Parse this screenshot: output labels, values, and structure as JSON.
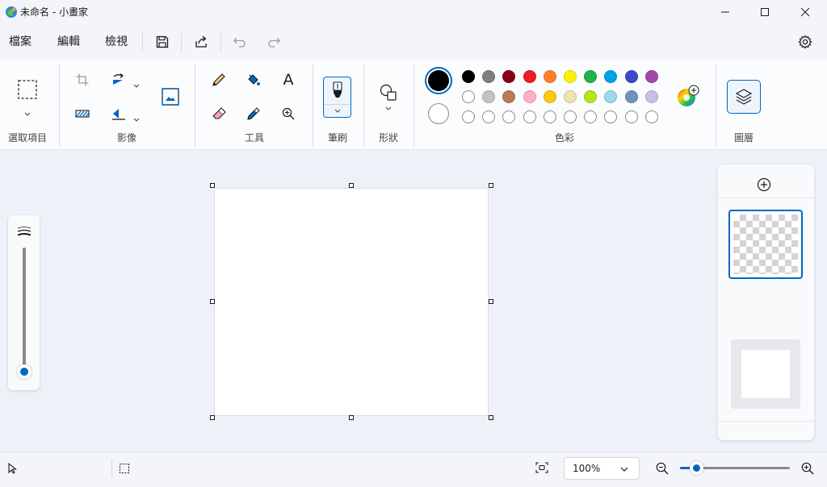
{
  "window": {
    "title": "未命名 - 小畫家",
    "icons": [
      "app-icon",
      "minimize-icon",
      "maximize-icon",
      "close-icon"
    ]
  },
  "menu": {
    "items": [
      "檔案",
      "編輯",
      "檢視"
    ],
    "toolbar_icons": [
      "save-icon",
      "share-icon",
      "undo-icon",
      "redo-icon",
      "settings-icon"
    ]
  },
  "ribbon": {
    "groups": {
      "selection": "選取項目",
      "image": "影像",
      "tools": "工具",
      "brushes": "筆刷",
      "shapes": "形狀",
      "colors": "色彩",
      "layers": "圖層"
    },
    "text_tool_glyph": "A"
  },
  "colors": {
    "primary": "#000000",
    "secondary": "#ffffff",
    "accent": "#0067c0",
    "palette_row1": [
      "#000000",
      "#7f7f7f",
      "#880015",
      "#ed1c24",
      "#ff7f27",
      "#fff200",
      "#22b14c",
      "#00a2e8",
      "#3f48cc",
      "#a349a4"
    ],
    "palette_row2": [
      "#ffffff",
      "#c3c3c3",
      "#b97a57",
      "#ffaec9",
      "#ffc90e",
      "#efe4b0",
      "#b5e61d",
      "#99d9ea",
      "#7092be",
      "#c8bfe7"
    ],
    "custom_row_count": 10
  },
  "brush_size": {
    "level": 0.0
  },
  "status": {
    "zoom_value": "100%",
    "zoom_slider_level": 0.15
  }
}
